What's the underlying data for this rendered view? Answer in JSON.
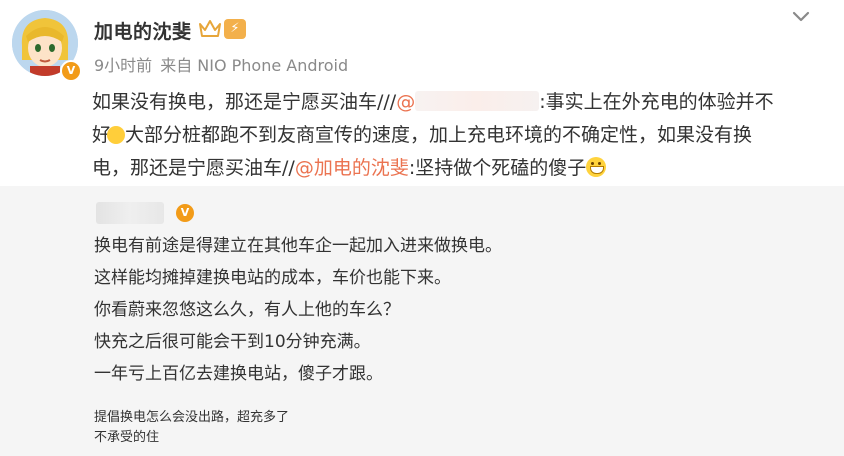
{
  "author": {
    "name": "加电的沈斐",
    "level_badge": "⚡",
    "avatar_icon": "anime-avatar",
    "verified_badge": "V"
  },
  "meta": {
    "time": "9小时前",
    "source": "来自 NIO Phone Android"
  },
  "post": {
    "line1_prefix": "如果没有换电，那还是宁愿买油车///",
    "line1_at": "@",
    "line1_suffix": ":事实上在外充电的体验并不",
    "line2_start": "好",
    "line2_rest": "大部分桩都跑不到友商宣传的速度，加上充电环境的不确定性，如果没有换",
    "line3_start": "电，那还是宁愿买油车//",
    "line3_mention": "@加电的沈斐",
    "line3_end": ":坚持做个死磕的傻子"
  },
  "repost": {
    "verified_badge": "V",
    "lines": [
      "换电有前途是得建立在其他车企一起加入进来做换电。",
      "这样能均摊掉建换电站的成本，车价也能下来。",
      "你看蔚来忽悠这么久，有人上他的车么？",
      "快充之后很可能会干到10分钟充满。",
      "一年亏上百亿去建换电站，傻子才跟。"
    ],
    "quote_lines": [
      "提倡换电怎么会没出路，超充多了",
      "不承受的住"
    ]
  },
  "colors": {
    "mention": "#eb7350",
    "underline": "#e43a3a",
    "repost_bg": "#f5f5f5",
    "meta_text": "#8a8a8a"
  }
}
